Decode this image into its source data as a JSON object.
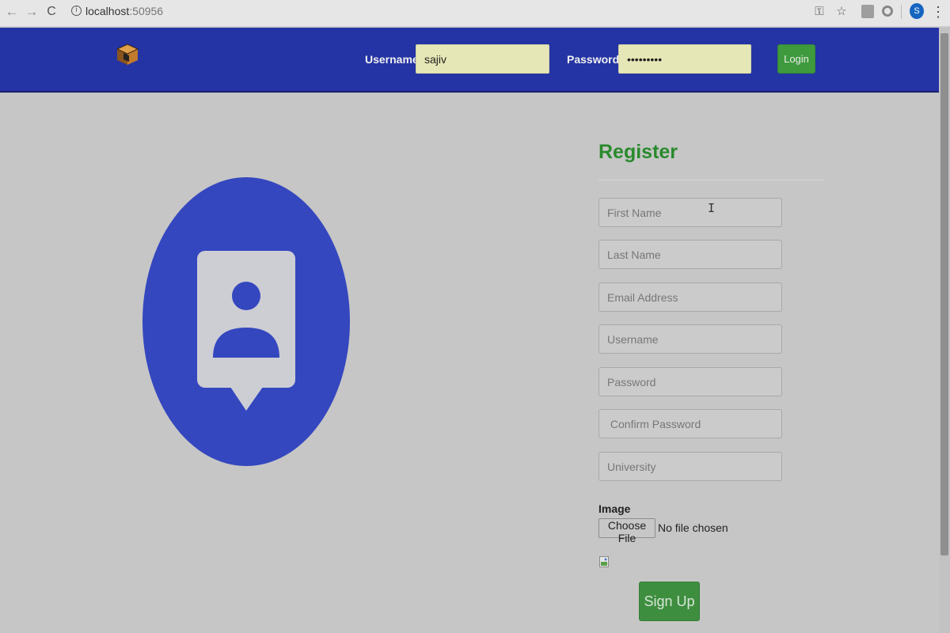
{
  "browser": {
    "back_icon": "←",
    "forward_icon": "→",
    "reload_icon": "C",
    "url_host": "localhost",
    "url_port": ":50956",
    "key_icon": "⚿",
    "star_icon": "☆",
    "profile_initial": "S",
    "menu_icon": "⋮"
  },
  "header": {
    "username_label": "Username",
    "username_value": "sajiv",
    "password_label": "Password",
    "password_value": "sajivpass",
    "login_label": "Login",
    "background_color": "#2534a4"
  },
  "register": {
    "title": "Register",
    "fields": [
      {
        "placeholder": "First Name"
      },
      {
        "placeholder": "Last Name"
      },
      {
        "placeholder": "Email Address"
      },
      {
        "placeholder": "Username"
      },
      {
        "placeholder": "Password"
      },
      {
        "placeholder": " Confirm Password"
      },
      {
        "placeholder": "University"
      }
    ],
    "image_label": "Image",
    "choose_file_label": "Choose File",
    "no_file_text": "No file chosen",
    "signup_label": "Sign Up",
    "title_color": "#2a8a2d"
  },
  "illustration": {
    "icon": "user-contact-icon",
    "circle_color": "#3447bf"
  }
}
